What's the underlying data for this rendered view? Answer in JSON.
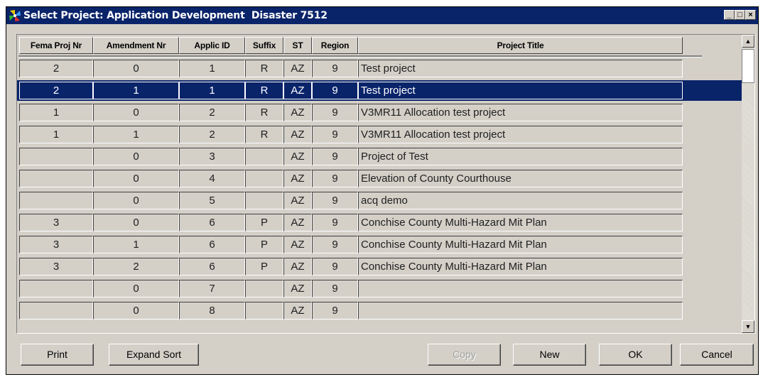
{
  "window": {
    "title": "Select Project: Application Development  Disaster 7512",
    "controls": {
      "minimize": "_",
      "maximize": "□",
      "close": "×"
    }
  },
  "table": {
    "columns": [
      "Fema Proj Nr",
      "Amendment Nr",
      "Applic ID",
      "Suffix",
      "ST",
      "Region",
      "Project Title"
    ],
    "rows": [
      [
        "2",
        "0",
        "1",
        "R",
        "AZ",
        "9",
        "Test project"
      ],
      [
        "2",
        "1",
        "1",
        "R",
        "AZ",
        "9",
        "Test project"
      ],
      [
        "1",
        "0",
        "2",
        "R",
        "AZ",
        "9",
        "V3MR11 Allocation test project"
      ],
      [
        "1",
        "1",
        "2",
        "R",
        "AZ",
        "9",
        "V3MR11 Allocation test project"
      ],
      [
        "",
        "0",
        "3",
        "",
        "AZ",
        "9",
        "Project of Test"
      ],
      [
        "",
        "0",
        "4",
        "",
        "AZ",
        "9",
        "Elevation of County Courthouse"
      ],
      [
        "",
        "0",
        "5",
        "",
        "AZ",
        "9",
        "acq demo"
      ],
      [
        "3",
        "0",
        "6",
        "P",
        "AZ",
        "9",
        "Conchise County Multi-Hazard Mit Plan"
      ],
      [
        "3",
        "1",
        "6",
        "P",
        "AZ",
        "9",
        "Conchise County Multi-Hazard Mit Plan"
      ],
      [
        "3",
        "2",
        "6",
        "P",
        "AZ",
        "9",
        "Conchise County Multi-Hazard Mit Plan"
      ],
      [
        "",
        "0",
        "7",
        "",
        "AZ",
        "9",
        ""
      ],
      [
        "",
        "0",
        "8",
        "",
        "AZ",
        "9",
        ""
      ]
    ],
    "selected_row": 1
  },
  "scrollbar": {
    "up_glyph": "▲",
    "down_glyph": "▼"
  },
  "buttons": {
    "print": "Print",
    "expand_sort": "Expand Sort",
    "copy": "Copy",
    "new": "New",
    "ok": "OK",
    "cancel": "Cancel"
  },
  "colors": {
    "title_bar": "#0a246a",
    "selection": "#0a246a",
    "face": "#d4d0c8",
    "disabled_text": "#a0a0a0"
  },
  "icons": {
    "app": "pinwheel-app-icon",
    "minimize": "minimize-icon",
    "maximize": "maximize-icon",
    "close": "close-icon"
  }
}
